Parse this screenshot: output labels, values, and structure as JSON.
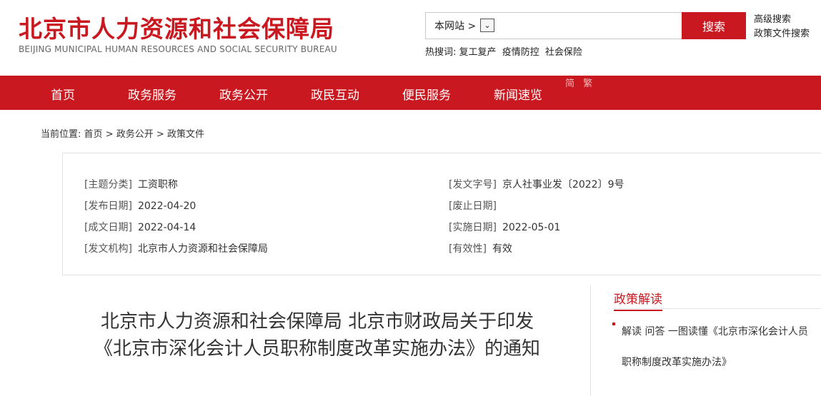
{
  "header": {
    "logo_cn": "北京市人力资源和社会保障局",
    "logo_en": "BEIJING MUNICIPAL HUMAN RESOURCES AND SOCIAL SECURITY BUREAU",
    "search": {
      "scope_label": "本网站 >",
      "query": "",
      "button": "搜索"
    },
    "advanced_search": "高级搜索",
    "policy_search": "政策文件搜索",
    "hotwords_label": "热搜词:",
    "hotwords": [
      "复工复产",
      "疫情防控",
      "社会保险"
    ]
  },
  "nav": {
    "items": [
      "首页",
      "政务服务",
      "政务公开",
      "政民互动",
      "便民服务",
      "新闻速览"
    ],
    "lang": "简 繁"
  },
  "breadcrumb": {
    "label": "当前位置:",
    "items": [
      "首页",
      "政务公开",
      "政策文件"
    ],
    "separator": ">"
  },
  "meta": {
    "topic": {
      "label": "[主题分类]",
      "value": "工资职称"
    },
    "doc_no": {
      "label": "[发文字号]",
      "value": "京人社事业发〔2022〕9号"
    },
    "publish_date": {
      "label": "[发布日期]",
      "value": "2022-04-20"
    },
    "repeal_date": {
      "label": "[废止日期]",
      "value": ""
    },
    "written_date": {
      "label": "[成文日期]",
      "value": "2022-04-14"
    },
    "effective_date": {
      "label": "[实施日期]",
      "value": "2022-05-01"
    },
    "issuer": {
      "label": "[发文机构]",
      "value": "北京市人力资源和社会保障局"
    },
    "validity": {
      "label": "[有效性]",
      "value": "有效"
    }
  },
  "article": {
    "title": "北京市人力资源和社会保障局 北京市财政局关于印发《北京市深化会计人员职称制度改革实施办法》的通知"
  },
  "side": {
    "title": "政策解读",
    "link": "解读 问答 一图读懂《北京市深化会计人员职称制度改革实施办法》"
  },
  "colors": {
    "brand_red": "#c9181f"
  }
}
